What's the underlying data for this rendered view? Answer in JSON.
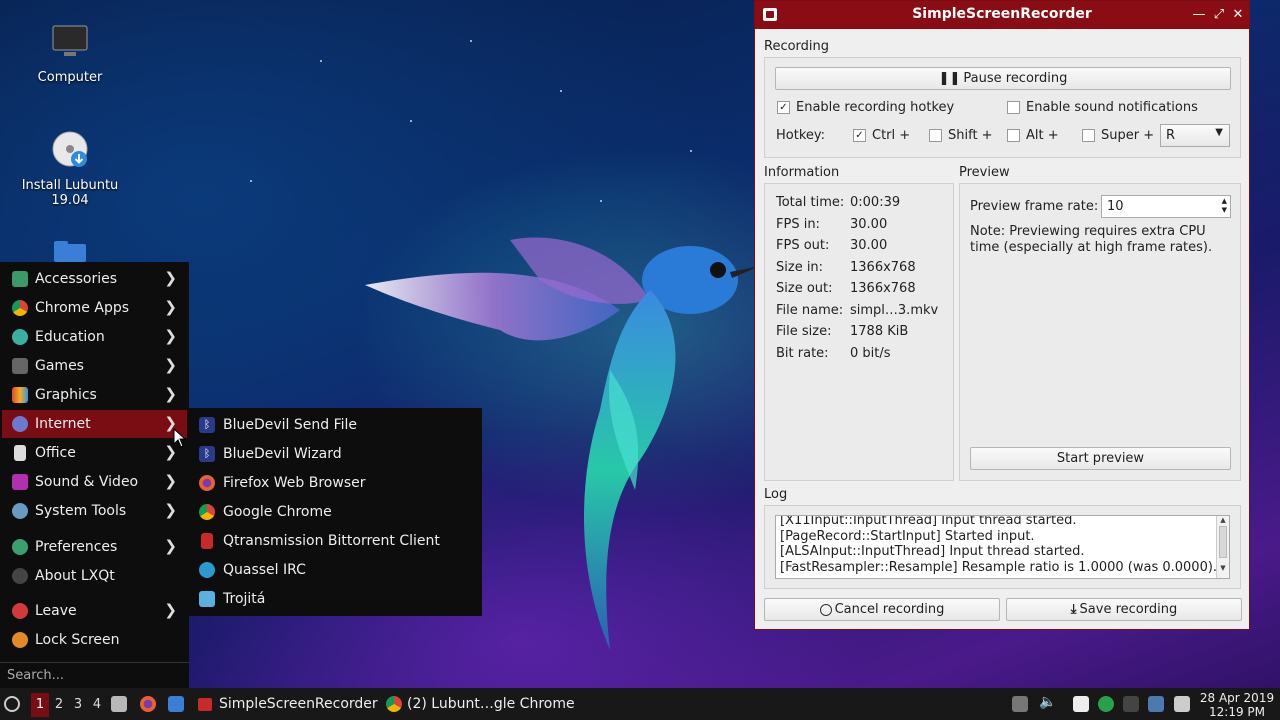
{
  "desktop": {
    "icons": [
      {
        "label": "Computer"
      },
      {
        "label": "Install Lubuntu 19.04"
      }
    ]
  },
  "menu": {
    "items": [
      {
        "label": "Accessories",
        "icon": "accessories-icon"
      },
      {
        "label": "Chrome Apps",
        "icon": "chrome-icon"
      },
      {
        "label": "Education",
        "icon": "education-icon"
      },
      {
        "label": "Games",
        "icon": "games-icon"
      },
      {
        "label": "Graphics",
        "icon": "graphics-icon"
      },
      {
        "label": "Internet",
        "icon": "internet-icon"
      },
      {
        "label": "Office",
        "icon": "office-icon"
      },
      {
        "label": "Sound & Video",
        "icon": "sound-video-icon"
      },
      {
        "label": "System Tools",
        "icon": "system-tools-icon"
      },
      {
        "label": "Preferences",
        "icon": "preferences-icon"
      },
      {
        "label": "About LXQt",
        "icon": "info-icon"
      },
      {
        "label": "Leave",
        "icon": "leave-icon"
      },
      {
        "label": "Lock Screen",
        "icon": "lock-icon"
      }
    ],
    "search_placeholder": "Search...",
    "submenu": [
      {
        "label": "BlueDevil Send File",
        "icon": "bluetooth-icon"
      },
      {
        "label": "BlueDevil Wizard",
        "icon": "bluetooth-icon"
      },
      {
        "label": "Firefox Web Browser",
        "icon": "firefox-icon"
      },
      {
        "label": "Google Chrome",
        "icon": "chrome-icon"
      },
      {
        "label": "Qtransmission Bittorrent Client",
        "icon": "transmission-icon"
      },
      {
        "label": "Quassel IRC",
        "icon": "quassel-icon"
      },
      {
        "label": "Trojitá",
        "icon": "mail-icon"
      }
    ]
  },
  "taskbar": {
    "workspaces": [
      "1",
      "2",
      "3",
      "4"
    ],
    "tasks": [
      {
        "label": "SimpleScreenRecorder"
      },
      {
        "label": "(2) Lubunt…gle Chrome"
      }
    ],
    "date": "28 Apr 2019",
    "time": "12:19 PM"
  },
  "window": {
    "title": "SimpleScreenRecorder",
    "recording": {
      "section": "Recording",
      "pause_label": "Pause recording",
      "hotkey_enabled_label": "Enable recording hotkey",
      "sound_notifications_label": "Enable sound notifications",
      "hotkey_label": "Hotkey:",
      "ctrl_label": "Ctrl +",
      "shift_label": "Shift +",
      "alt_label": "Alt +",
      "super_label": "Super +",
      "key_value": "R"
    },
    "information": {
      "section": "Information",
      "rows": [
        {
          "key": "Total time:",
          "value": "0:00:39"
        },
        {
          "key": "FPS in:",
          "value": "30.00"
        },
        {
          "key": "FPS out:",
          "value": "30.00"
        },
        {
          "key": "Size in:",
          "value": "1366x768"
        },
        {
          "key": "Size out:",
          "value": "1366x768"
        },
        {
          "key": "File name:",
          "value": "simpl…3.mkv"
        },
        {
          "key": "File size:",
          "value": "1788 KiB"
        },
        {
          "key": "Bit rate:",
          "value": "0 bit/s"
        }
      ]
    },
    "preview": {
      "section": "Preview",
      "frame_rate_label": "Preview frame rate:",
      "frame_rate_value": "10",
      "note": "Note: Previewing requires extra CPU time (especially at high frame rates).",
      "start_label": "Start preview"
    },
    "log": {
      "section": "Log",
      "lines": [
        "[X11Input::InputThread] Input thread started.",
        "[PageRecord::StartInput] Started input.",
        "[ALSAInput::InputThread] Input thread started.",
        "[FastResampler::Resample] Resample ratio is 1.0000 (was 0.0000)."
      ]
    },
    "cancel_label": "Cancel recording",
    "save_label": "Save recording"
  }
}
